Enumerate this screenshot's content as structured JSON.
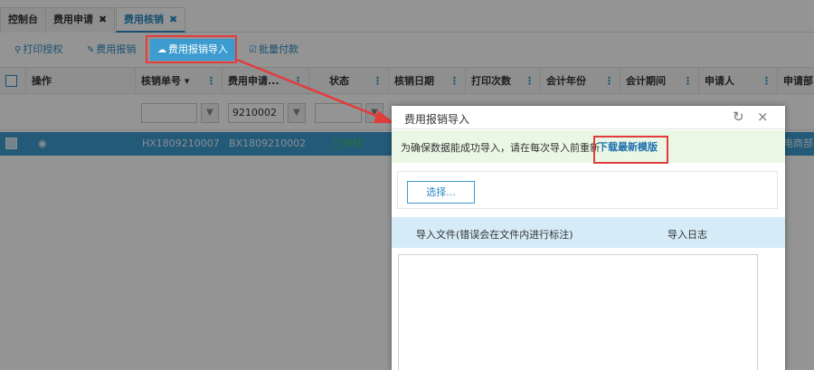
{
  "tabs": [
    {
      "label": "控制台",
      "closable": false,
      "active": false
    },
    {
      "label": "费用申请",
      "closable": true,
      "active": false
    },
    {
      "label": "费用核销",
      "closable": true,
      "active": true
    }
  ],
  "tab_close_glyph": "✖",
  "toolbar": {
    "print_auth": "打印授权",
    "expense_report": "费用报销",
    "import_report": "费用报销导入",
    "batch_pay": "批量付款"
  },
  "grid": {
    "columns": [
      "操作",
      "核销单号 ▾",
      "费用申请...",
      "状态",
      "核销日期",
      "打印次数",
      "会计年份",
      "会计期间",
      "申请人",
      "申请部"
    ],
    "filter_value": "9210002",
    "row": {
      "writeoff_no": "HX1809210007",
      "apply_no": "BX1809210002",
      "status": "已审核",
      "dept": "电商部"
    }
  },
  "modal": {
    "title": "费用报销导入",
    "notice_text": "为确保数据能成功导入，请在每次导入前重新",
    "notice_link": "下载最新模版",
    "select_button": "选择...",
    "col_file": "导入文件(错误会在文件内进行标注)",
    "col_log": "导入日志"
  },
  "colors": {
    "accent": "#3d9ccf",
    "highlight": "#e23c3c",
    "notice_bg": "#e9f7e4",
    "header_bg": "#d5ebf7"
  }
}
